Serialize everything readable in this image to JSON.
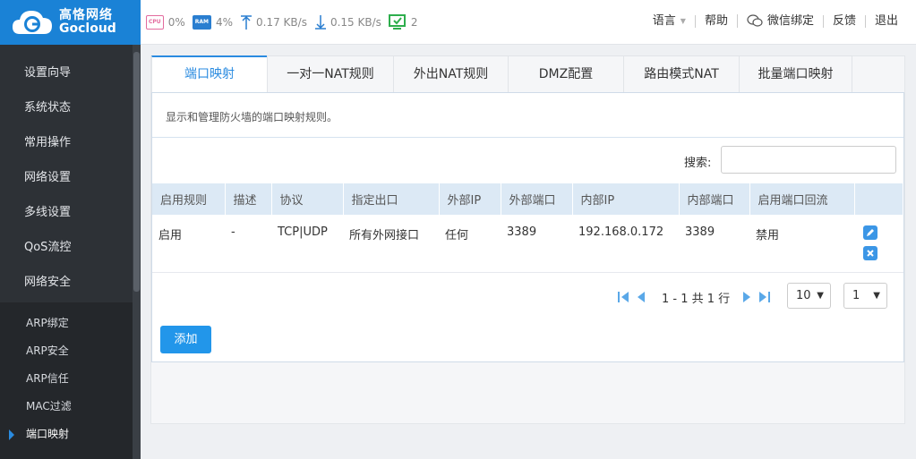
{
  "brand": {
    "name_cn": "高恪网络",
    "name_en": "Gocloud",
    "color": "#1a82d6"
  },
  "stats": {
    "cpu_label": "CPU",
    "cpu_value": "0%",
    "ram_label": "RAM",
    "ram_value": "4%",
    "upload": "0.17 KB/s",
    "download": "0.15 KB/s",
    "devices": "2"
  },
  "top_links": {
    "language": "语言",
    "help": "帮助",
    "wechat": "微信绑定",
    "feedback": "反馈",
    "logout": "退出"
  },
  "sidebar": {
    "items": [
      {
        "label": "设置向导"
      },
      {
        "label": "系统状态"
      },
      {
        "label": "常用操作"
      },
      {
        "label": "网络设置"
      },
      {
        "label": "多线设置"
      },
      {
        "label": "QoS流控"
      },
      {
        "label": "网络安全"
      }
    ],
    "subitems": [
      {
        "label": "ARP绑定"
      },
      {
        "label": "ARP安全"
      },
      {
        "label": "ARP信任"
      },
      {
        "label": "MAC过滤"
      },
      {
        "label": "端口映射",
        "active": true
      }
    ]
  },
  "tabs": [
    {
      "label": "端口映射",
      "active": true
    },
    {
      "label": "一对一NAT规则"
    },
    {
      "label": "外出NAT规则"
    },
    {
      "label": "DMZ配置"
    },
    {
      "label": "路由模式NAT"
    },
    {
      "label": "批量端口映射"
    }
  ],
  "panel": {
    "description": "显示和管理防火墙的端口映射规则。",
    "search_label": "搜索:",
    "search_value": ""
  },
  "table": {
    "headers": [
      "启用规则",
      "描述",
      "协议",
      "指定出口",
      "外部IP",
      "外部端口",
      "内部IP",
      "内部端口",
      "启用端口回流",
      ""
    ],
    "rows": [
      [
        "启用",
        "-",
        "TCP|UDP",
        "所有外网接口",
        "任何",
        "3389",
        "192.168.0.172",
        "3389",
        "禁用"
      ]
    ]
  },
  "pagination": {
    "summary": "1 - 1 共 1 行",
    "page_size": "10",
    "page": "1"
  },
  "add_button": "添加"
}
